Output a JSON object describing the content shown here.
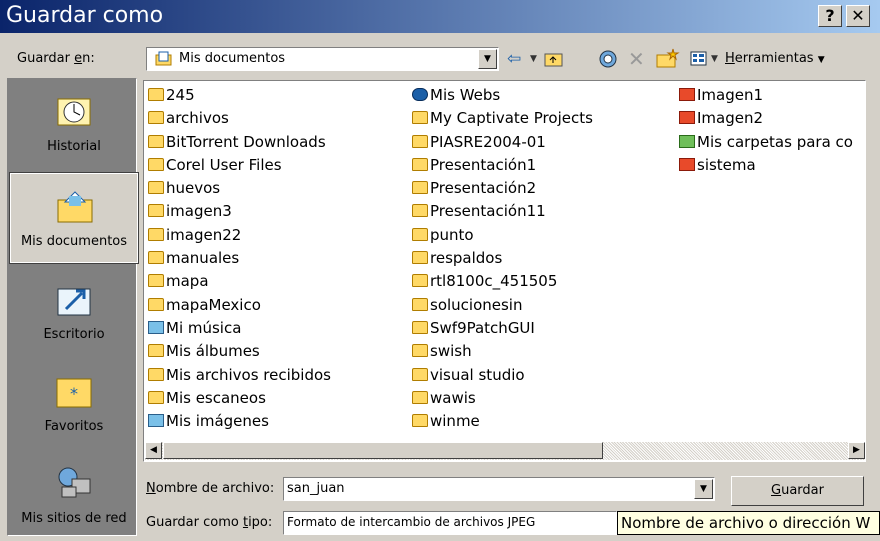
{
  "window": {
    "title": "Guardar como",
    "help_label": "?",
    "close_label": "✕"
  },
  "save_in": {
    "label_pre": "Guardar ",
    "label_key": "e",
    "label_post": "n:",
    "value": "Mis documentos"
  },
  "toolbar": {
    "back_icon": "back-arrow-icon",
    "up_icon": "up-folder-icon",
    "search_icon": "search-web-icon",
    "delete_icon": "delete-icon",
    "new_folder_icon": "new-folder-icon",
    "views_icon": "views-icon",
    "tools_key": "H",
    "tools_rest": "erramientas"
  },
  "places": [
    {
      "name": "Historial",
      "icon": "history-icon"
    },
    {
      "name": "Mis documentos",
      "icon": "my-documents-icon"
    },
    {
      "name": "Escritorio",
      "icon": "desktop-icon"
    },
    {
      "name": "Favoritos",
      "icon": "favorites-icon"
    },
    {
      "name": "Mis sitios de red",
      "icon": "network-places-icon"
    }
  ],
  "files": {
    "col1": [
      {
        "name": "245",
        "type": "folder"
      },
      {
        "name": "archivos",
        "type": "folder"
      },
      {
        "name": "BitTorrent Downloads",
        "type": "folder"
      },
      {
        "name": "Corel User Files",
        "type": "folder"
      },
      {
        "name": "huevos",
        "type": "folder"
      },
      {
        "name": "imagen3",
        "type": "folder"
      },
      {
        "name": "imagen22",
        "type": "folder"
      },
      {
        "name": "manuales",
        "type": "folder"
      },
      {
        "name": "mapa",
        "type": "folder"
      },
      {
        "name": "mapaMexico",
        "type": "folder"
      },
      {
        "name": "Mi música",
        "type": "music"
      },
      {
        "name": "Mis álbumes",
        "type": "folder"
      },
      {
        "name": "Mis archivos recibidos",
        "type": "folder"
      },
      {
        "name": "Mis escaneos",
        "type": "folder"
      },
      {
        "name": "Mis imágenes",
        "type": "music"
      }
    ],
    "col2": [
      {
        "name": "Mis Webs",
        "type": "web"
      },
      {
        "name": "My Captivate Projects",
        "type": "folder"
      },
      {
        "name": "PIASRE2004-01",
        "type": "folder"
      },
      {
        "name": "Presentación1",
        "type": "folder"
      },
      {
        "name": "Presentación2",
        "type": "folder"
      },
      {
        "name": "Presentación11",
        "type": "folder"
      },
      {
        "name": "punto",
        "type": "folder"
      },
      {
        "name": "respaldos",
        "type": "folder"
      },
      {
        "name": "rtl8100c_451505",
        "type": "folder"
      },
      {
        "name": "solucionesin",
        "type": "folder"
      },
      {
        "name": "Swf9PatchGUI",
        "type": "folder"
      },
      {
        "name": "swish",
        "type": "folder"
      },
      {
        "name": "visual studio",
        "type": "folder"
      },
      {
        "name": "wawis",
        "type": "folder"
      },
      {
        "name": "winme",
        "type": "folder"
      }
    ],
    "col3": [
      {
        "name": "Imagen1",
        "type": "image"
      },
      {
        "name": "Imagen2",
        "type": "image"
      },
      {
        "name": "Mis carpetas para co",
        "type": "net"
      },
      {
        "name": "sistema",
        "type": "image"
      }
    ]
  },
  "filename": {
    "label_key": "N",
    "label_rest": "ombre de archivo:",
    "value": "san_juan"
  },
  "filetype": {
    "label_pre": "Guardar como ",
    "label_key": "t",
    "label_post": "ipo:",
    "value": "Formato de intercambio de archivos JPEG"
  },
  "save_button": {
    "key": "G",
    "rest": "uardar"
  },
  "tooltip": "Nombre de archivo o dirección W",
  "colors": {
    "title_start": "#0a246a",
    "title_end": "#a6caf0",
    "face": "#d4d0c8",
    "tooltip_bg": "#ffffe1"
  }
}
